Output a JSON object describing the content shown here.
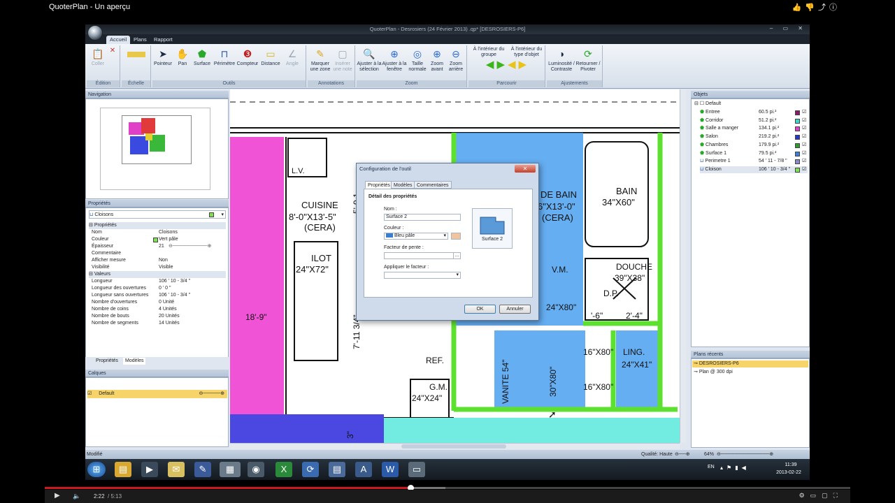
{
  "video": {
    "title": "QuoterPlan - Un aperçu",
    "time_current": "2:22",
    "time_total": "/ 5:13",
    "progress_percent": 45.4
  },
  "app": {
    "window_title": "QuoterPlan - Desrosiers (24 Février 2013) .qp* [DESROSIERS-P6]",
    "tabs": [
      "Accueil",
      "Plans",
      "Rapport"
    ],
    "ribbon": {
      "edition": {
        "label": "Édition",
        "coller": "Coller"
      },
      "echelle": {
        "label": "Échelle"
      },
      "outils": {
        "label": "Outils",
        "buttons": [
          "Pointeur",
          "Pan",
          "Surface",
          "Périmètre",
          "Compteur",
          "Distance",
          "Angle"
        ]
      },
      "annotations": {
        "label": "Annotations",
        "buttons": [
          "Marquer une zone",
          "Insérer une note"
        ]
      },
      "zoom": {
        "label": "Zoom",
        "buttons": [
          "Ajuster à la sélection",
          "Ajuster à la fenêtre",
          "Taille normale",
          "Zoom avant",
          "Zoom arrière"
        ]
      },
      "parcourir": {
        "label": "Parcourir",
        "buttons": [
          "À l'intérieur du groupe",
          "À l'intérieur du type d'objet"
        ]
      },
      "ajustements": {
        "label": "Ajustements",
        "buttons": [
          "Luminosité / Contraste",
          "Retourner / Pivoter"
        ]
      }
    },
    "navigation": {
      "title": "Navigation"
    },
    "proprietes": {
      "title": "Propriétés",
      "selected": "Cloisons",
      "section_props": "Propriétés",
      "rows": [
        {
          "k": "Nom",
          "v": "Cloisons"
        },
        {
          "k": "Couleur",
          "v": "Vert pâle"
        },
        {
          "k": "Épaisseur",
          "v": "21"
        },
        {
          "k": "Commentaire",
          "v": ""
        },
        {
          "k": "Afficher mesure",
          "v": "Non"
        },
        {
          "k": "Visibilité",
          "v": "Visible"
        }
      ],
      "section_vals": "Valeurs",
      "vals": [
        {
          "k": "Longueur",
          "v": "106 ' 10 - 3/4 \""
        },
        {
          "k": "Longueur des ouvertures",
          "v": "0 ' 0 \""
        },
        {
          "k": "Longueur sans ouvertures",
          "v": "106 ' 10 - 3/4 \""
        },
        {
          "k": "Nombre d'ouvertures",
          "v": "0 Unité"
        },
        {
          "k": "Nombre de coins",
          "v": "4 Unités"
        },
        {
          "k": "Nombre de bouts",
          "v": "20 Unités"
        },
        {
          "k": "Nombre de segments",
          "v": "14 Unités"
        }
      ],
      "tabs": [
        "Propriétés",
        "Modèles"
      ]
    },
    "calques": {
      "title": "Calques",
      "items": [
        "Default"
      ]
    },
    "objets": {
      "title": "Objets",
      "root": "Default",
      "items": [
        {
          "name": "Entree",
          "value": "60.5 pi.²",
          "color": "#8b1a6b"
        },
        {
          "name": "Corridor",
          "value": "51.2 pi.²",
          "color": "#3fd4c8"
        },
        {
          "name": "Salle a manger",
          "value": "134.1 pi.²",
          "color": "#e040c8"
        },
        {
          "name": "Salon",
          "value": "219.2 pi.²",
          "color": "#2a36c8"
        },
        {
          "name": "Chambres",
          "value": "179.9 pi.²",
          "color": "#2f9a2f"
        },
        {
          "name": "Surface 1",
          "value": "79.5 pi.²",
          "color": "#3a80d8"
        },
        {
          "name": "Perimetre 1",
          "value": "54 ' 11 - 7/8 \"",
          "color": "#8a8ac8"
        },
        {
          "name": "Cloison",
          "value": "106 ' 10 - 3/4 \"",
          "color": "#7fe050"
        }
      ]
    },
    "plans_recents": {
      "title": "Plans récents",
      "items": [
        "DESROSIERS-P6",
        "Plan @ 300 dpi"
      ]
    },
    "statusbar": {
      "left": "Modifié",
      "quality": "Qualité: Haute",
      "zoom": "64%"
    },
    "dialog": {
      "title": "Configuration de l'outil",
      "close": "✕",
      "tabs": [
        "Propriétés",
        "Modèles",
        "Commentaires"
      ],
      "section": "Détail des propriétés",
      "nom_label": "Nom :",
      "nom_value": "Surface 2",
      "couleur_label": "Couleur :",
      "couleur_value": "Bleu pâle",
      "pente_label": "Facteur de pente :",
      "appliquer_label": "Appliquer le facteur :",
      "preview_label": "Surface 2",
      "ok": "OK",
      "cancel": "Annuler"
    },
    "plan_labels": {
      "lv": "L.V.",
      "cuisine": "CUISINE",
      "cuisine_dim": "8'-0\"X13'-5\"",
      "cera1": "(CERA)",
      "ilot": "ILOT",
      "ilot_dim": "24\"X72\"",
      "d189": "18'-9\"",
      "d7113": "7'-11 3/4\"",
      "d59": "5'-9 1",
      "ref": "REF.",
      "gm": "G.M.",
      "gm_dim": "24\"X24\"",
      "sdb": "DE BAIN",
      "sdb_dim": "6\"X13'-0\"",
      "cera2": "(CERA)",
      "bain": "BAIN",
      "bain_dim": "34\"X60\"",
      "vm": "V.M.",
      "v24x80": "24\"X80\"",
      "douche": "DOUCHE",
      "douche_dim": "39\"X38\"",
      "dp": "D.P.",
      "d16": "'-6\"",
      "d24": "2'-4\"",
      "vanite": "VANITE 54\"",
      "v30x80": "30\"X80\"",
      "v16a": "16\"X80\"",
      "v16b": "16\"X80\"",
      "ling": "LING.",
      "ling_dim": "24\"X41\"",
      "d3": "3\""
    },
    "tray": {
      "lang": "EN",
      "time": "11:39",
      "date": "2013-02-22"
    }
  }
}
